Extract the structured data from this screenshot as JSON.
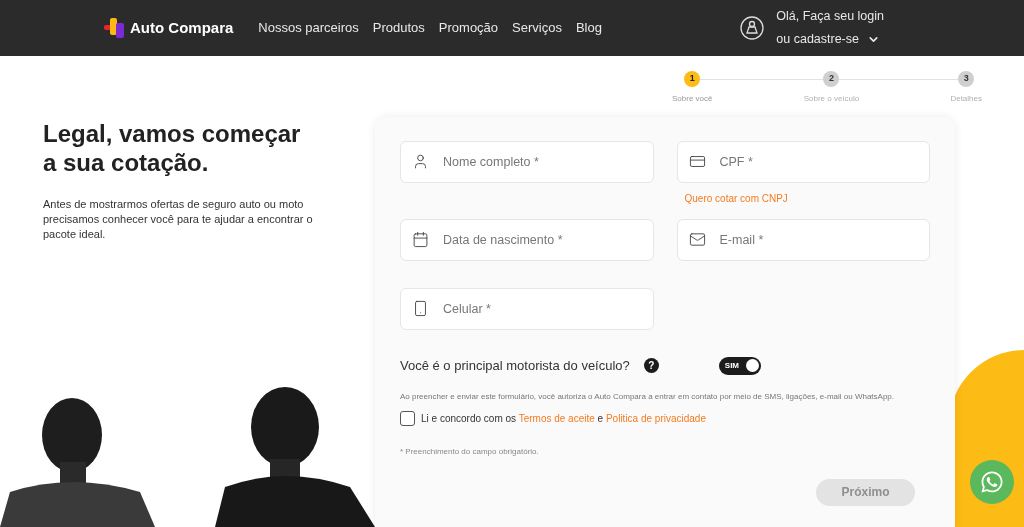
{
  "header": {
    "logo": "Auto Compara",
    "nav": [
      "Nossos parceiros",
      "Produtos",
      "Promoção",
      "Serviços",
      "Blog"
    ],
    "login": {
      "line1": "Olá, Faça seu login",
      "line2": "ou cadastre-se"
    }
  },
  "stepper": [
    {
      "number": "1",
      "label": "Sobre você",
      "selected": true
    },
    {
      "number": "2",
      "label": "Sobre o veículo",
      "selected": false
    },
    {
      "number": "3",
      "label": "Detalhes",
      "selected": false
    }
  ],
  "intro": {
    "title": "Legal, vamos começar a sua cotação.",
    "text": "Antes de mostrarmos ofertas de seguro auto ou moto precisamos conhecer você para te ajudar a encontrar o pacote ideal."
  },
  "form": {
    "rows": [
      [
        {
          "kind": "person",
          "placeholder": "Nome completo *"
        },
        {
          "kind": "document",
          "placeholder": "CPF *",
          "link": "Quero cotar com CNPJ"
        }
      ],
      [
        {
          "kind": "date",
          "placeholder": "Data de nascimento *"
        },
        {
          "kind": "email",
          "placeholder": "E-mail *"
        }
      ],
      [
        {
          "kind": "phone",
          "placeholder": "Celular *"
        }
      ]
    ],
    "question": {
      "label": "Você é o principal motorista do veículo?",
      "help": "?",
      "toggle": {
        "label": "SIM",
        "on": true
      }
    },
    "consent_note": "Ao preencher e enviar este formulário, você autoriza o Auto Compara a entrar em contato por meio de SMS, ligações, e-mail ou WhatsApp.",
    "terms": {
      "checked": false,
      "parts": [
        {
          "kind": "text",
          "text": "Li e concordo com os "
        },
        {
          "kind": "link",
          "text": "Termos de aceite"
        },
        {
          "kind": "text",
          "text": " e "
        },
        {
          "kind": "link",
          "text": "Politica de privacidade"
        }
      ]
    },
    "required_note": "* Preenchimento do campo obrigatório.",
    "next_button": {
      "label": "Próximo",
      "disabled": true
    }
  }
}
